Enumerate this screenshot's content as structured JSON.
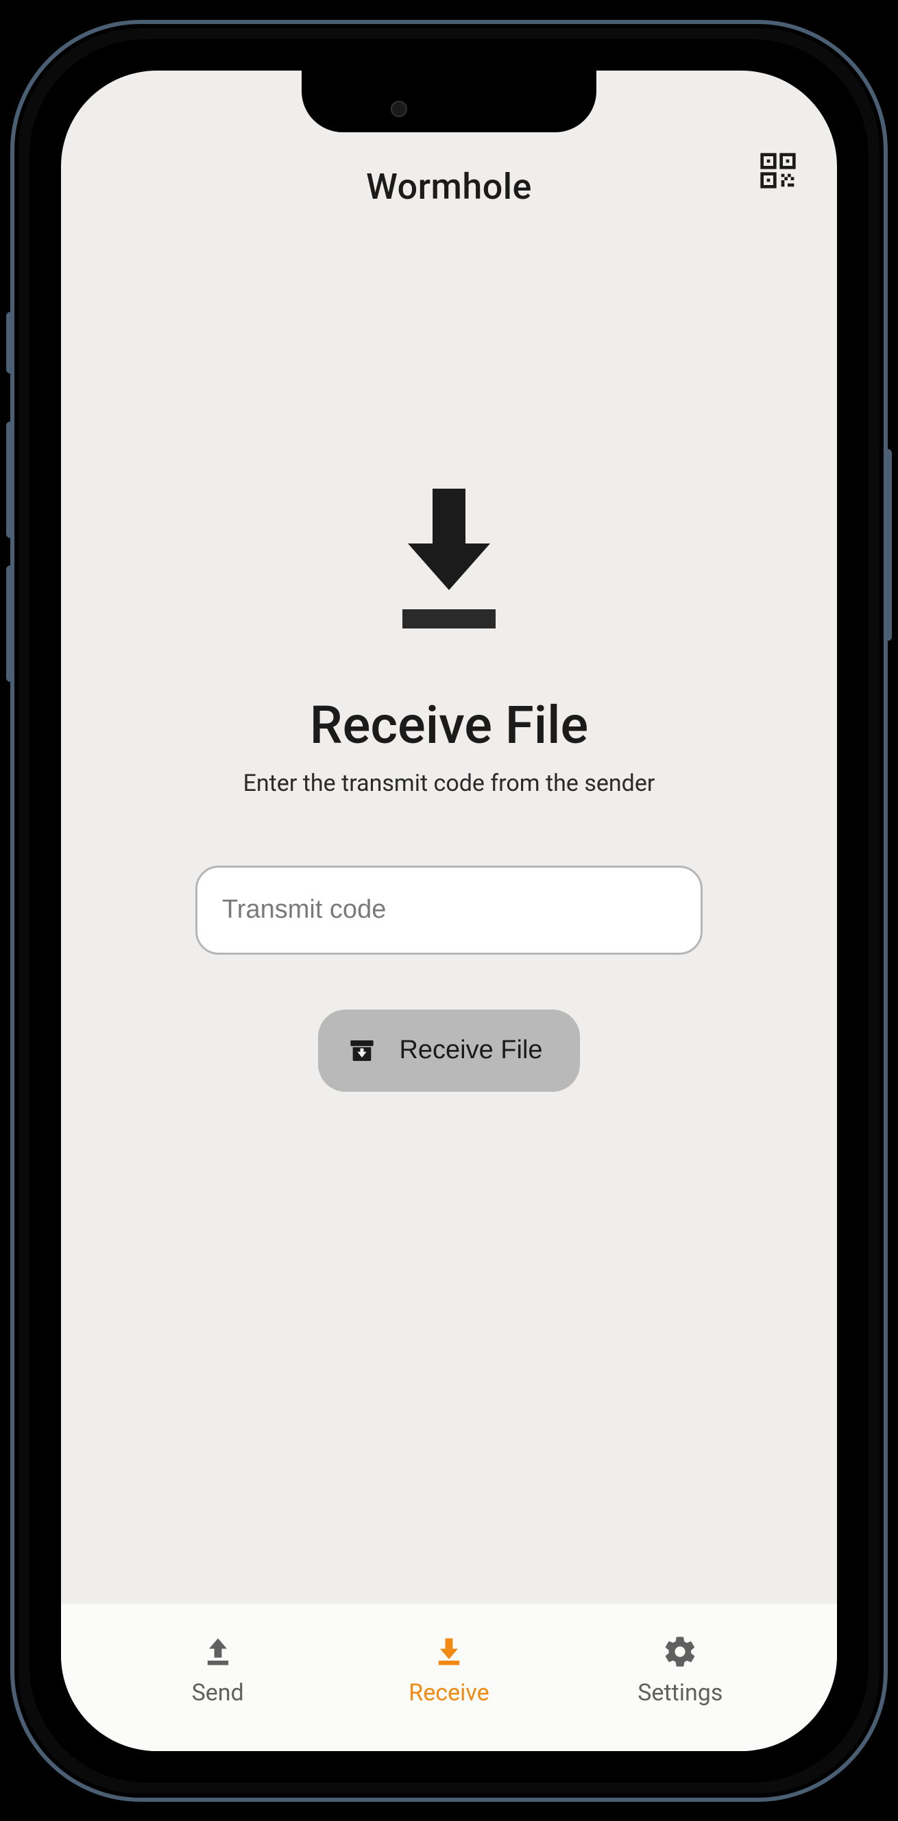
{
  "header": {
    "title": "Wormhole",
    "qr_icon": "qr-code-icon"
  },
  "main": {
    "icon": "download-icon",
    "title": "Receive File",
    "subtitle": "Enter the transmit code from the sender",
    "code_input": {
      "placeholder": "Transmit code",
      "value": ""
    },
    "receive_button": {
      "label": "Receive File",
      "icon": "archive-download-icon"
    }
  },
  "tabs": [
    {
      "id": "send",
      "label": "Send",
      "icon": "upload-icon",
      "active": false
    },
    {
      "id": "receive",
      "label": "Receive",
      "icon": "download-icon",
      "active": true
    },
    {
      "id": "settings",
      "label": "Settings",
      "icon": "gear-icon",
      "active": false
    }
  ],
  "colors": {
    "accent": "#f08a12",
    "bg": "#efeeed",
    "text": "#1b1b1b",
    "muted": "#606060"
  }
}
